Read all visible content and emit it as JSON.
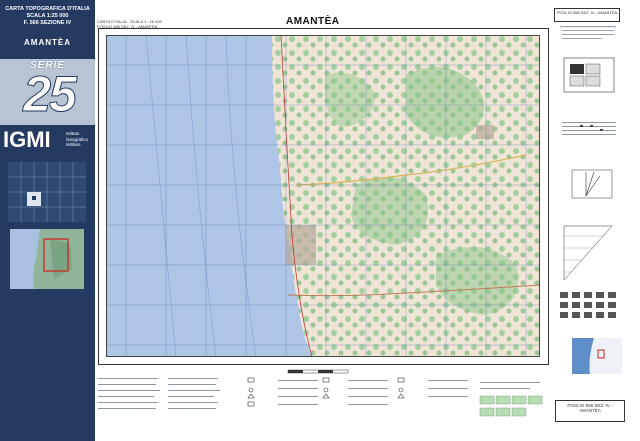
{
  "cover": {
    "header_lines": [
      "CARTA TOPOGRAFICA D'ITALIA",
      "SCALA 1:25 000",
      "F. 566 SEZIONE IV"
    ],
    "sheet_name": "AMANTÈA",
    "series_label": "SERIE",
    "series_number": "25",
    "igmi_logo": "IGMI",
    "institute_lines": [
      "Istituto",
      "Geografico",
      "Militare"
    ],
    "colors": {
      "panel": "#243a60",
      "band": "#b8c3d3",
      "green_tile": "#8fb49a",
      "red_box": "#d12020"
    }
  },
  "map": {
    "top_left_lines": [
      "CARTA D'ITALIA - SCALA 1 : 25 000",
      "FOGLIO 566 SEZ. IV - AMANTÈA"
    ],
    "title": "AMANTÈA",
    "colors": {
      "sea": "#aec5e6",
      "land": "#efe5d7",
      "vegetation": "#8cc68a",
      "grid": "#5e7fae"
    }
  },
  "right_panel": {
    "sheet_lines": [
      "FOGLIO 566 SEZ. IV - AMANTÈA"
    ],
    "bottom_sheet_lines": [
      "FOGLIO 566 SEZ. IV - AMANTÈA"
    ]
  }
}
